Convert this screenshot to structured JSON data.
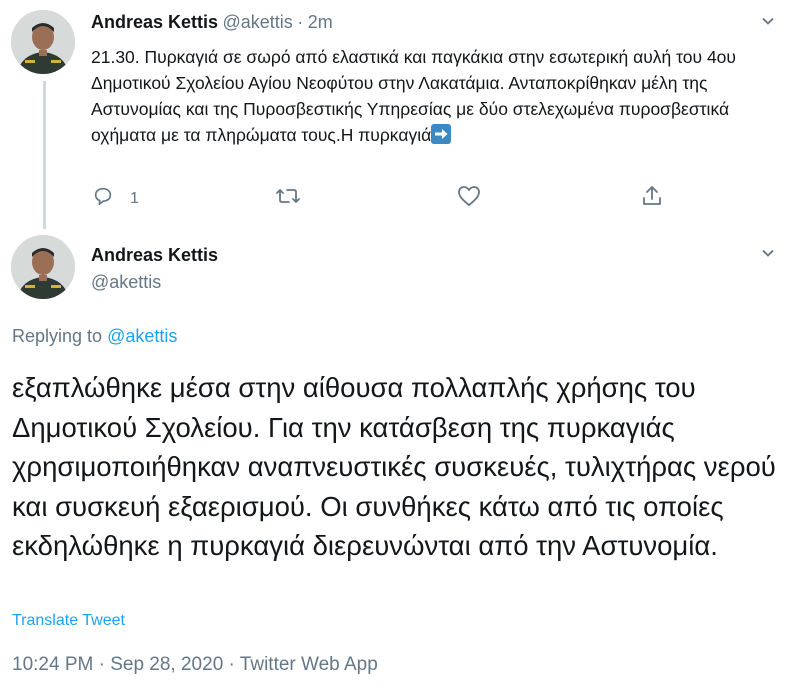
{
  "tweet1": {
    "author_name": "Andreas Kettis",
    "handle": "@akettis",
    "separator": "·",
    "time": "2m",
    "text": "21.30. Πυρκαγιά σε σωρό από ελαστικά και παγκάκια στην εσωτερική αυλή του 4ου  Δημοτικού Σχολείου Αγίου Νεοφύτου στην Λακατάμια. Ανταποκρίθηκαν μέλη της Αστυνομίας και της Πυροσβεστικής Υπηρεσίας με δύο στελεχωμένα πυροσβεστικά οχήματα με τα πληρώματα τους.Η πυρκαγιά",
    "reply_count": "1",
    "icons": [
      "reply-icon",
      "retweet-icon",
      "like-icon",
      "share-icon",
      "arrow-right-emoji",
      "chevron-down-icon"
    ]
  },
  "tweet2": {
    "author_name": "Andreas Kettis",
    "handle": "@akettis",
    "replying_prefix": "Replying to",
    "replying_to": "@akettis",
    "text": "εξαπλώθηκε μέσα στην αίθουσα πολλαπλής χρήσης του Δημοτικού Σχολείου. Για την κατάσβεση της πυρκαγιάς χρησιμοποιήθηκαν αναπνευστικές συσκευές, τυλιχτήρας νερού και συσκευή εξαερισμού. Οι συνθήκες κάτω από τις οποίες εκδηλώθηκε η πυρκαγιά διερευνώνται από την Αστυνομία.",
    "translate_label": "Translate Tweet",
    "timestamp": "10:24 PM · Sep 28, 2020 · Twitter Web App"
  },
  "colors": {
    "accent": "#1da1f2",
    "secondary_text": "#657786",
    "primary_text": "#14171a",
    "thread_line": "#cfd9de"
  }
}
